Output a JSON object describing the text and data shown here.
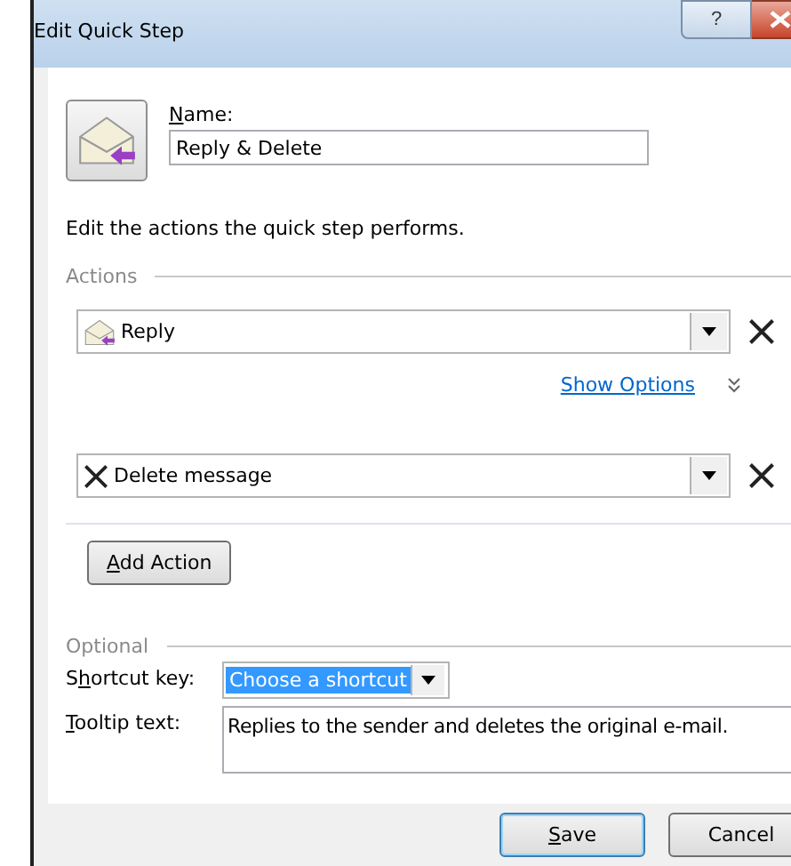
{
  "window": {
    "title": "Edit Quick Step",
    "help_label": "?"
  },
  "name": {
    "label": {
      "key": "N",
      "post": "ame:"
    },
    "value": "Reply & Delete"
  },
  "instructions": "Edit the actions the quick step performs.",
  "actions": {
    "legend": "Actions",
    "items": [
      {
        "kind": "reply",
        "label": "Reply",
        "show_options": "Show Options"
      },
      {
        "kind": "delete",
        "label": "Delete message"
      }
    ],
    "add_button": {
      "label": {
        "key": "A",
        "post": "dd Action"
      }
    }
  },
  "optional": {
    "legend": "Optional",
    "shortcut": {
      "label": {
        "pre": "S",
        "key": "h",
        "post": "ortcut key:"
      },
      "value": "Choose a shortcut",
      "selected": true
    },
    "tooltip": {
      "label": {
        "key": "T",
        "post": "ooltip text:"
      },
      "value": "Replies to the sender and deletes the original e-mail."
    }
  },
  "buttons": [
    {
      "label": {
        "key": "S",
        "post": "ave"
      },
      "default": true
    },
    {
      "label": {
        "post": "Cancel"
      },
      "default": false
    }
  ]
}
